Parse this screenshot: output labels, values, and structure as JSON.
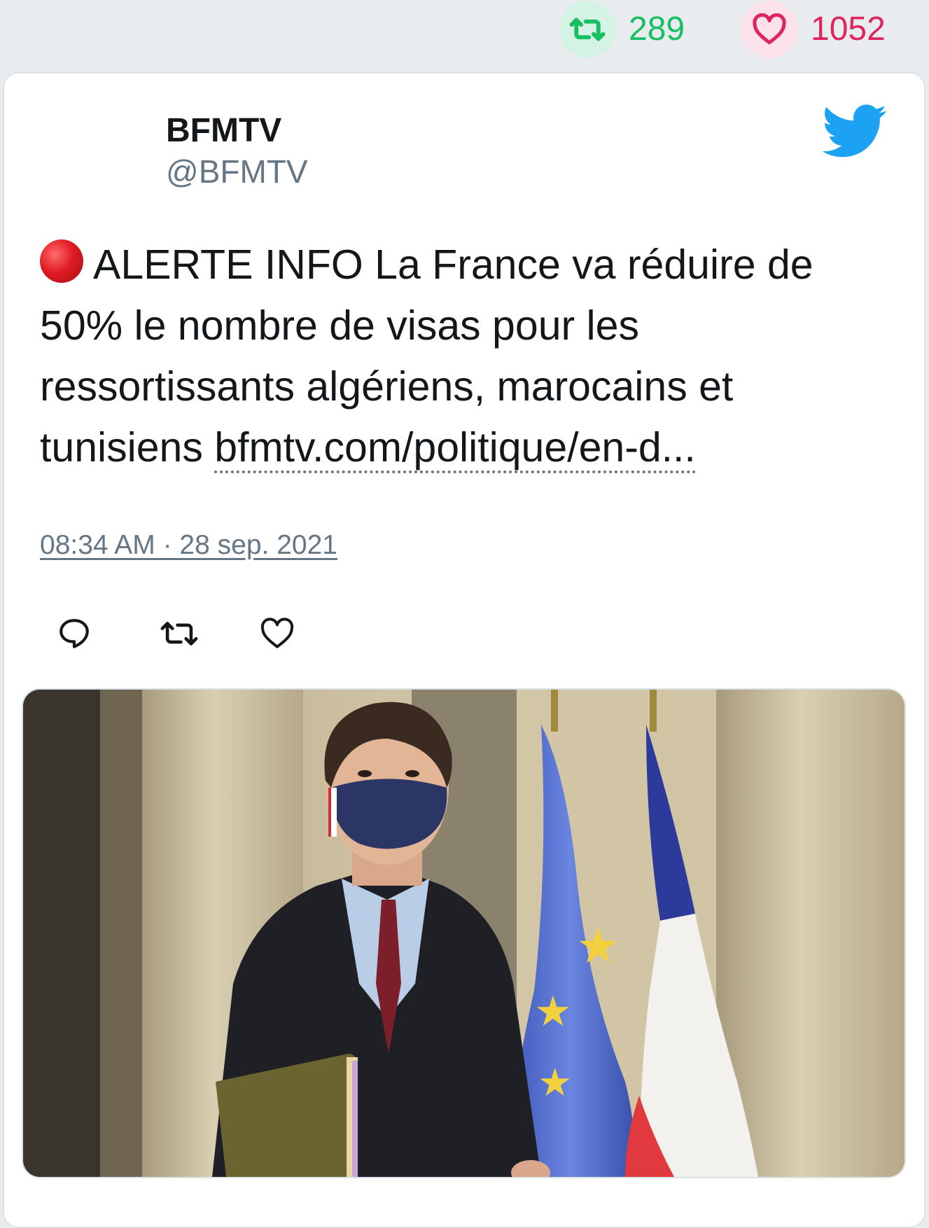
{
  "stats": {
    "retweet_icon": "retweet-icon",
    "retweet_count": "289",
    "like_icon": "heart-icon",
    "like_count": "1052",
    "retweet_color": "#17bf63",
    "like_color": "#e0245e"
  },
  "tweet": {
    "author_name": "BFMTV",
    "author_handle": "@BFMTV",
    "platform_icon": "twitter-bird-icon",
    "alert_icon": "red-circle-icon",
    "text": "ALERTE INFO La France va réduire de 50% le nombre de visas pour les ressortissants algériens, marocains et tunisiens",
    "link_text": "bfmtv.com/politique/en-d...",
    "timestamp": "08:34 AM · 28 sep. 2021",
    "actions": [
      {
        "name": "reply",
        "icon": "reply-icon"
      },
      {
        "name": "retweet",
        "icon": "retweet-icon"
      },
      {
        "name": "like",
        "icon": "heart-icon"
      }
    ]
  },
  "media": {
    "type": "photo"
  },
  "colors": {
    "text": "#14171a",
    "secondary": "#657786",
    "twitter_blue": "#1da1f2"
  }
}
